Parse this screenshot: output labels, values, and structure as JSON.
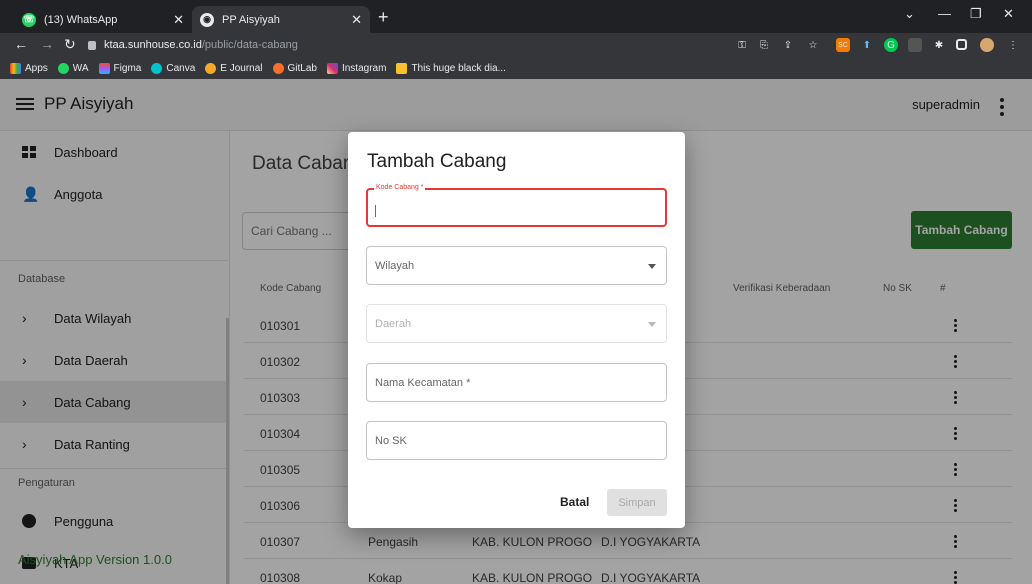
{
  "browser": {
    "tabs": [
      {
        "title": "(13) WhatsApp",
        "icon": "whatsapp-icon"
      },
      {
        "title": "PP Aisyiyah",
        "icon": "globe-icon"
      }
    ],
    "url_host": "ktaa.sunhouse.co.id",
    "url_path": "/public/data-cabang",
    "bookmarks": [
      "Apps",
      "WA",
      "Figma",
      "Canva",
      "E Journal",
      "GitLab",
      "Instagram",
      "This huge black dia..."
    ]
  },
  "app": {
    "brand": "PP Aisyiyah",
    "user": "superadmin",
    "accent": "#2e7d32"
  },
  "sidebar": {
    "items": [
      {
        "label": "Dashboard",
        "icon": "dashboard-icon"
      },
      {
        "label": "Anggota",
        "icon": "person-icon"
      },
      {
        "label": "Data Wilayah",
        "icon": "chevron-right-icon"
      },
      {
        "label": "Data Daerah",
        "icon": "chevron-right-icon"
      },
      {
        "label": "Data Cabang",
        "icon": "chevron-right-icon"
      },
      {
        "label": "Data Ranting",
        "icon": "chevron-right-icon"
      },
      {
        "label": "Pengguna",
        "icon": "account-circle-icon"
      },
      {
        "label": "KTA",
        "icon": "badge-icon"
      }
    ],
    "section_database": "Database",
    "section_pengaturan": "Pengaturan",
    "version": "Aisyiyah App Version 1.0.0"
  },
  "main": {
    "title": "Data Cabang",
    "search_placeholder": "Cari Cabang ...",
    "add_button": "Tambah Cabang",
    "columns": [
      "Kode Cabang",
      "Verifikasi Keberadaan",
      "No SK",
      "#"
    ],
    "rows": [
      {
        "kode": "010301",
        "nama": "",
        "daerah": "",
        "wilayah": "TA"
      },
      {
        "kode": "010302",
        "nama": "",
        "daerah": "",
        "wilayah": "TA"
      },
      {
        "kode": "010303",
        "nama": "",
        "daerah": "",
        "wilayah": "TA"
      },
      {
        "kode": "010304",
        "nama": "",
        "daerah": "",
        "wilayah": "TA"
      },
      {
        "kode": "010305",
        "nama": "",
        "daerah": "",
        "wilayah": "TA"
      },
      {
        "kode": "010306",
        "nama": "",
        "daerah": "",
        "wilayah": "TA"
      },
      {
        "kode": "010307",
        "nama": "Pengasih",
        "daerah": "KAB. KULON PROGO",
        "wilayah": "D.I YOGYAKARTA"
      },
      {
        "kode": "010308",
        "nama": "Kokap",
        "daerah": "KAB. KULON PROGO",
        "wilayah": "D.I YOGYAKARTA"
      }
    ]
  },
  "dialog": {
    "title": "Tambah Cabang",
    "kode_label": "Kode Cabang *",
    "kode_value": "",
    "wilayah_placeholder": "Wilayah",
    "daerah_placeholder": "Daerah",
    "kecamatan_placeholder": "Nama Kecamatan *",
    "nosk_placeholder": "No SK",
    "cancel": "Batal",
    "save": "Simpan"
  }
}
